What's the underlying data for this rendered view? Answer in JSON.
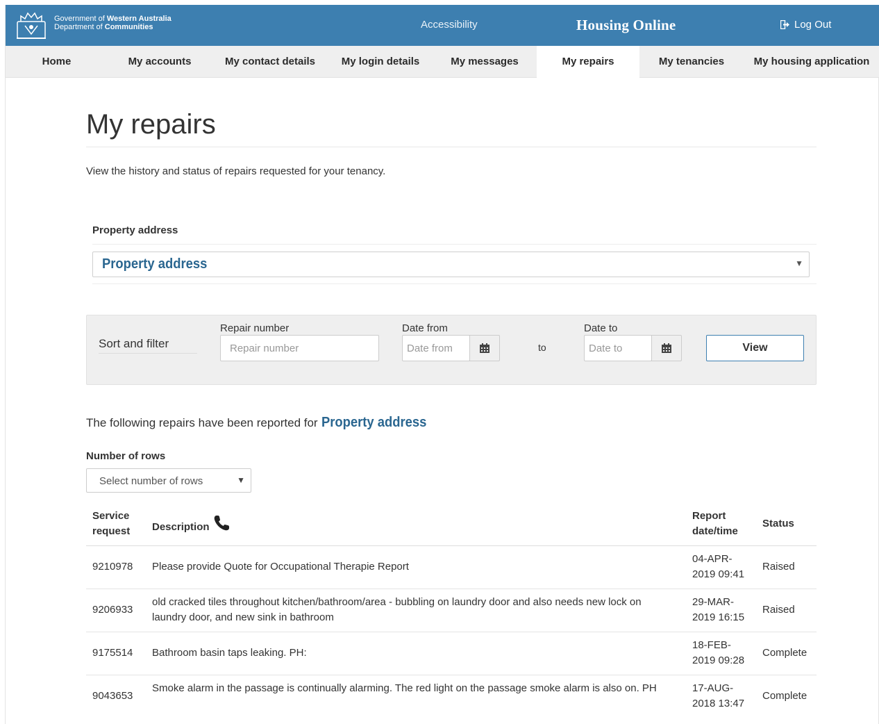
{
  "header": {
    "gov_line1_prefix": "Government of ",
    "gov_line1_bold": "Western Australia",
    "gov_line2_prefix": "Department of ",
    "gov_line2_bold": "Communities",
    "accessibility": "Accessibility",
    "brand": "Housing Online",
    "logout": "Log Out"
  },
  "nav": {
    "items": [
      {
        "label": "Home"
      },
      {
        "label": "My accounts"
      },
      {
        "label": "My contact details"
      },
      {
        "label": "My login details"
      },
      {
        "label": "My messages"
      },
      {
        "label": "My repairs",
        "active": true
      },
      {
        "label": "My tenancies"
      },
      {
        "label": "My housing application"
      }
    ]
  },
  "page": {
    "title": "My repairs",
    "intro": "View the history and status of repairs requested for your tenancy."
  },
  "property": {
    "label": "Property address",
    "selected": "Property address"
  },
  "filter": {
    "title": "Sort and filter",
    "repair_label": "Repair number",
    "repair_placeholder": "Repair number",
    "from_label": "Date from",
    "from_placeholder": "Date from",
    "to_word": "to",
    "to_label": "Date to",
    "to_placeholder": "Date to",
    "view_button": "View"
  },
  "results": {
    "intro": "The following repairs have been reported for",
    "property": "Property address"
  },
  "rows_control": {
    "label": "Number of rows",
    "selected": "Select number of rows"
  },
  "table": {
    "headers": {
      "service_1": "Service",
      "service_2": "request",
      "description": "Description",
      "report_1": "Report",
      "report_2": "date/time",
      "status": "Status"
    },
    "rows": [
      {
        "id": "9210978",
        "desc_1": "Please provide Quote for Occupational Therapie Report",
        "desc_2": "",
        "date_1": "04-APR-",
        "date_2": "2019 09:41",
        "status": "Raised"
      },
      {
        "id": "9206933",
        "desc_1": "old cracked tiles throughout kitchen/bathroom/area - bubbling on laundry door and also needs new lock on",
        "desc_2": "laundry door, and new sink in bathroom",
        "date_1": "29-MAR-",
        "date_2": "2019 16:15",
        "status": "Raised"
      },
      {
        "id": "9175514",
        "desc_1": "Bathroom basin taps leaking. PH:",
        "desc_2": "",
        "date_1": "18-FEB-",
        "date_2": "2019 09:28",
        "status": "Complete"
      },
      {
        "id": "9043653",
        "desc_1": "Smoke alarm in the passage is continually alarming. The red light on the passage smoke alarm is also on. PH",
        "desc_2": "",
        "date_1": "17-AUG-",
        "date_2": "2018 13:47",
        "status": "Complete"
      }
    ]
  },
  "colors": {
    "header_blue": "#3d7fb0",
    "link_blue": "#2a6690",
    "nav_bg": "#efefef"
  }
}
